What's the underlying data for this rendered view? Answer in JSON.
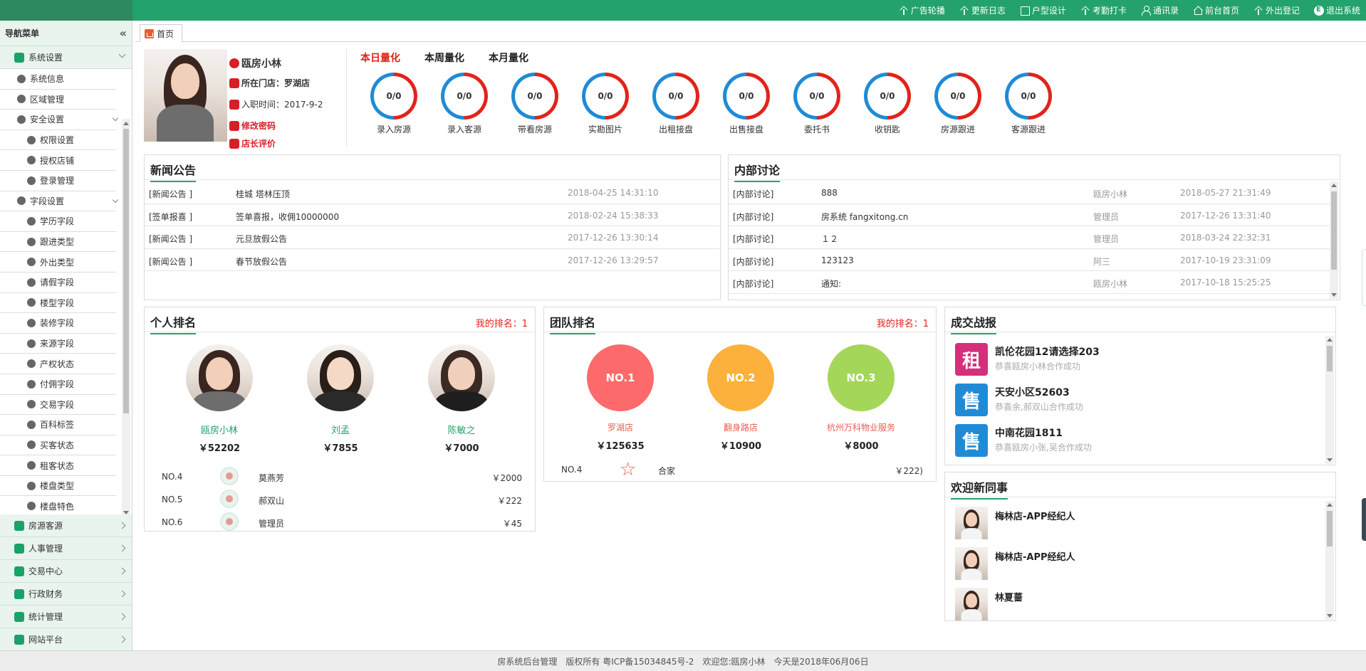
{
  "topnav": [
    {
      "label": "广告轮播",
      "icon": "up-arrow-icon"
    },
    {
      "label": "更新日志",
      "icon": "up-arrow-icon"
    },
    {
      "label": "户型设计",
      "icon": "box-icon"
    },
    {
      "label": "考勤打卡",
      "icon": "up-arrow-icon"
    },
    {
      "label": "通讯录",
      "icon": "user-icon"
    },
    {
      "label": "前台首页",
      "icon": "home-icon"
    },
    {
      "label": "外出登记",
      "icon": "up-arrow-icon"
    },
    {
      "label": "退出系统",
      "icon": "exit-icon"
    }
  ],
  "sidebar": {
    "title": "导航菜单",
    "collapse_glyph": "«",
    "open_group": "系统设置",
    "tree": [
      {
        "label": "系统信息",
        "level": 1
      },
      {
        "label": "区域管理",
        "level": 1
      },
      {
        "label": "安全设置",
        "level": 1,
        "expandable": true
      },
      {
        "label": "权限设置",
        "level": 2
      },
      {
        "label": "授权店铺",
        "level": 2
      },
      {
        "label": "登录管理",
        "level": 2
      },
      {
        "label": "字段设置",
        "level": 1,
        "expandable": true
      },
      {
        "label": "学历字段",
        "level": 2
      },
      {
        "label": "跟进类型",
        "level": 2
      },
      {
        "label": "外出类型",
        "level": 2
      },
      {
        "label": "请假字段",
        "level": 2
      },
      {
        "label": "楼型字段",
        "level": 2
      },
      {
        "label": "装修字段",
        "level": 2
      },
      {
        "label": "来源字段",
        "level": 2
      },
      {
        "label": "产权状态",
        "level": 2
      },
      {
        "label": "付佣字段",
        "level": 2
      },
      {
        "label": "交易字段",
        "level": 2
      },
      {
        "label": "百科标签",
        "level": 2
      },
      {
        "label": "买客状态",
        "level": 2
      },
      {
        "label": "租客状态",
        "level": 2
      },
      {
        "label": "楼盘类型",
        "level": 2
      },
      {
        "label": "楼盘特色",
        "level": 2
      }
    ],
    "groups": [
      "房源客源",
      "人事管理",
      "交易中心",
      "行政财务",
      "统计管理",
      "网站平台"
    ]
  },
  "tabs": {
    "home": "首页"
  },
  "profile": {
    "name": "瓯房小林",
    "store": "所在门店：罗湖店",
    "join_date": "入职时间：2017-9-2",
    "change_password": "修改密码",
    "manager_eval": "店长评价"
  },
  "quant": {
    "tabs": [
      "本日量化",
      "本周量化",
      "本月量化"
    ],
    "active_tab": "本日量化",
    "items": [
      {
        "label": "录入房源",
        "value": "0/0"
      },
      {
        "label": "录入客源",
        "value": "0/0"
      },
      {
        "label": "带看房源",
        "value": "0/0"
      },
      {
        "label": "实勘图片",
        "value": "0/0"
      },
      {
        "label": "出租接盘",
        "value": "0/0"
      },
      {
        "label": "出售接盘",
        "value": "0/0"
      },
      {
        "label": "委托书",
        "value": "0/0"
      },
      {
        "label": "收钥匙",
        "value": "0/0"
      },
      {
        "label": "房源跟进",
        "value": "0/0"
      },
      {
        "label": "客源跟进",
        "value": "0/0"
      }
    ]
  },
  "news": {
    "title": "新闻公告",
    "rows": [
      {
        "type": "[新闻公告 ]",
        "text": "桂城 塔林压顶",
        "time": "2018-04-25 14:31:10"
      },
      {
        "type": "[签单报喜 ]",
        "text": "签单喜报，收佣10000000",
        "time": "2018-02-24 15:38:33"
      },
      {
        "type": "[新闻公告 ]",
        "text": "元旦放假公告",
        "time": "2017-12-26 13:30:14"
      },
      {
        "type": "[新闻公告 ]",
        "text": "春节放假公告",
        "time": "2017-12-26 13:29:57"
      }
    ]
  },
  "discussion": {
    "title": "内部讨论",
    "rows": [
      {
        "type": "[内部讨论]",
        "text": "888",
        "author": "瓯房小林",
        "time": "2018-05-27 21:31:49"
      },
      {
        "type": "[内部讨论]",
        "text": "房系统 fangxitong.cn",
        "author": "管理员",
        "time": "2017-12-26 13:31:40"
      },
      {
        "type": "[内部讨论]",
        "text": "１２",
        "author": "管理员",
        "time": "2018-03-24 22:32:31"
      },
      {
        "type": "[内部讨论]",
        "text": "123123",
        "author": "阿三",
        "time": "2017-10-19 23:31:09"
      },
      {
        "type": "[内部讨论]",
        "text": "通知:",
        "author": "瓯房小林",
        "time": "2017-10-18 15:25:25"
      }
    ]
  },
  "personal_rank": {
    "title": "个人排名",
    "my_rank": "我的排名：1",
    "top": [
      {
        "name": "瓯房小林",
        "amount": "￥52202"
      },
      {
        "name": "刘孟",
        "amount": "￥7855"
      },
      {
        "name": "陈敏之",
        "amount": "￥7000"
      }
    ],
    "others": [
      {
        "rank": "NO.4",
        "name": "莫燕芳",
        "amount": "￥2000"
      },
      {
        "rank": "NO.5",
        "name": "郝双山",
        "amount": "￥222"
      },
      {
        "rank": "NO.6",
        "name": "管理员",
        "amount": "￥45"
      }
    ]
  },
  "team_rank": {
    "title": "团队排名",
    "my_rank": "我的排名：1",
    "top": [
      {
        "badge": "NO.1",
        "name": "罗湖店",
        "amount": "￥125635",
        "color": "#fd6a6b"
      },
      {
        "badge": "NO.2",
        "name": "翻身路店",
        "amount": "￥10900",
        "color": "#fbb13c"
      },
      {
        "badge": "NO.3",
        "name": "杭州万科物业服务",
        "amount": "￥8000",
        "color": "#a4d65a"
      }
    ],
    "others": [
      {
        "rank": "NO.4",
        "name": "合家",
        "amount": "￥222)"
      }
    ]
  },
  "deals": {
    "title": "成交战报",
    "items": [
      {
        "badge": "租",
        "color": "#d52f7b",
        "title": "凯伦花园12请选择203",
        "sub": "恭喜瓯房小林合作成功"
      },
      {
        "badge": "售",
        "color": "#1f8bd6",
        "title": "天安小区52603",
        "sub": "恭喜余,郝双山合作成功"
      },
      {
        "badge": "售",
        "color": "#1f8bd6",
        "title": "中南花园1811",
        "sub": "恭喜瓯房小张,吴合作成功"
      }
    ]
  },
  "newstaff": {
    "title": "欢迎新同事",
    "items": [
      {
        "name": "梅林店-APP经纪人"
      },
      {
        "name": "梅林店-APP经纪人"
      },
      {
        "name": "林夏蔷"
      }
    ]
  },
  "footer": {
    "system": "房系统后台管理",
    "copyright": "版权所有 粤ICP备15034845号-2",
    "welcome": "欢迎您:瓯房小林",
    "today": "今天是2018年06月06日"
  }
}
